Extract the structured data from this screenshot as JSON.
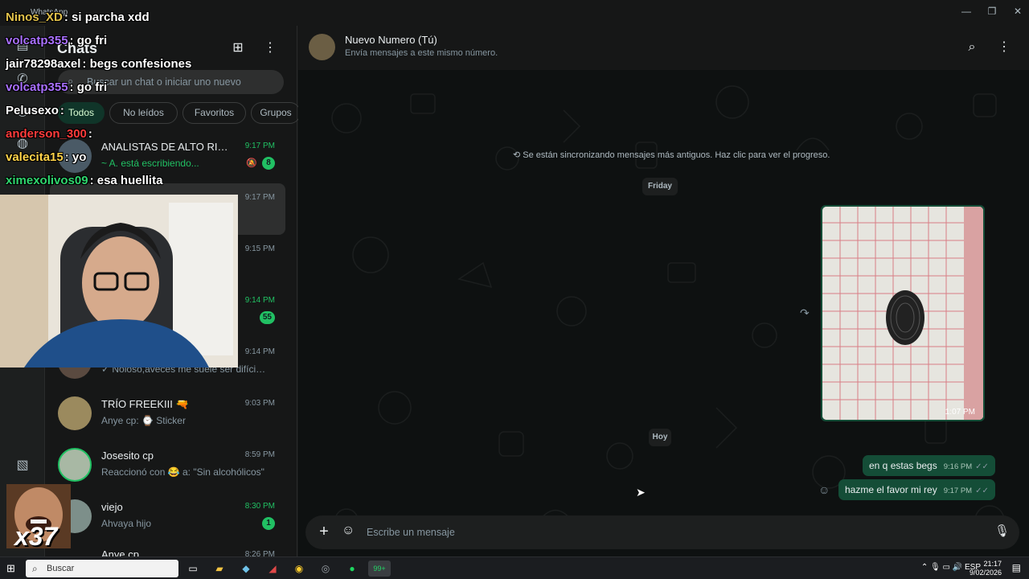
{
  "window": {
    "app_name": "WhatsApp",
    "minimize": "—",
    "maximize": "❐",
    "close": "✕"
  },
  "sidebar": {
    "title": "Chats",
    "search_placeholder": "Buscar un chat o iniciar uno nuevo",
    "filters": [
      "Todos",
      "No leídos",
      "Favoritos",
      "Grupos"
    ],
    "chats": [
      {
        "name": "ANALISTAS DE ALTO RIESG...",
        "time": "9:17 PM",
        "preview": "~ A. está escribiendo...",
        "badge": "8",
        "muted": true
      },
      {
        "name": "",
        "time": "9:17 PM",
        "preview": ""
      },
      {
        "name": "",
        "time": "9:15 PM",
        "preview": ""
      },
      {
        "name": "",
        "time": "9:14 PM",
        "preview": "",
        "badge": "55"
      },
      {
        "name": "",
        "time": "9:14 PM",
        "preview": "✓ Noloso,aveces me suele ser difícil t..."
      },
      {
        "name": "TRÍO FREEKIII 🔫",
        "time": "9:03 PM",
        "preview": "Anye cp: ⌚ Sticker"
      },
      {
        "name": "Josesito cp",
        "time": "8:59 PM",
        "preview": "Reaccionó con 😂 a: \"Sin alcohólicos\""
      },
      {
        "name": "viejo",
        "time": "8:30 PM",
        "preview": "Ahvaya hijo",
        "badge": "1"
      },
      {
        "name": "Anye cp",
        "time": "8:26 PM",
        "preview": ""
      }
    ]
  },
  "conversation": {
    "contact_name": "Nuevo Numero (Tú)",
    "contact_subtitle": "Envía mensajes a este mismo número.",
    "sync_notice": "⟲ Se están sincronizando mensajes más antiguos. Haz clic para ver el progreso.",
    "day_friday": "Friday",
    "image_time": "1:07 PM",
    "day_today": "Hoy",
    "messages": [
      {
        "text": "en q estas begs",
        "time": "9:16 PM"
      },
      {
        "text": "hazme el favor mi rey",
        "time": "9:17 PM"
      }
    ],
    "composer_placeholder": "Escribe un mensaje"
  },
  "stream_chat": [
    {
      "user": "Ninos_XD",
      "text": ": si parcha xdd",
      "color": "#e0c04a"
    },
    {
      "user": "volcatp355",
      "text": ": go fri",
      "color": "#a970ff"
    },
    {
      "user": "jair78298axel",
      "text": ": begs confesiones",
      "color": "#ffffff"
    },
    {
      "user": "volcatp355",
      "text": ": go fri",
      "color": "#a970ff"
    },
    {
      "user": "Pelusexo",
      "text": ":",
      "color": "#ffffff"
    },
    {
      "user": "anderson_300",
      "text": ":",
      "color": "#ff3b3b"
    },
    {
      "user": "valecita15",
      "text": ": yo",
      "color": "#ffd34a"
    },
    {
      "user": "ximexolivos09",
      "text": ": esa huellita",
      "color": "#2fd66e"
    }
  ],
  "emote_counter": "x37",
  "taskbar": {
    "search_label": "Buscar",
    "lang": "ESP",
    "time": "21:17",
    "date": "9/02/2026",
    "whatsapp_badge": "99+"
  },
  "colors": {
    "accent": "#21c063",
    "outgoing_bubble": "#144d37",
    "background": "#0e1111"
  }
}
